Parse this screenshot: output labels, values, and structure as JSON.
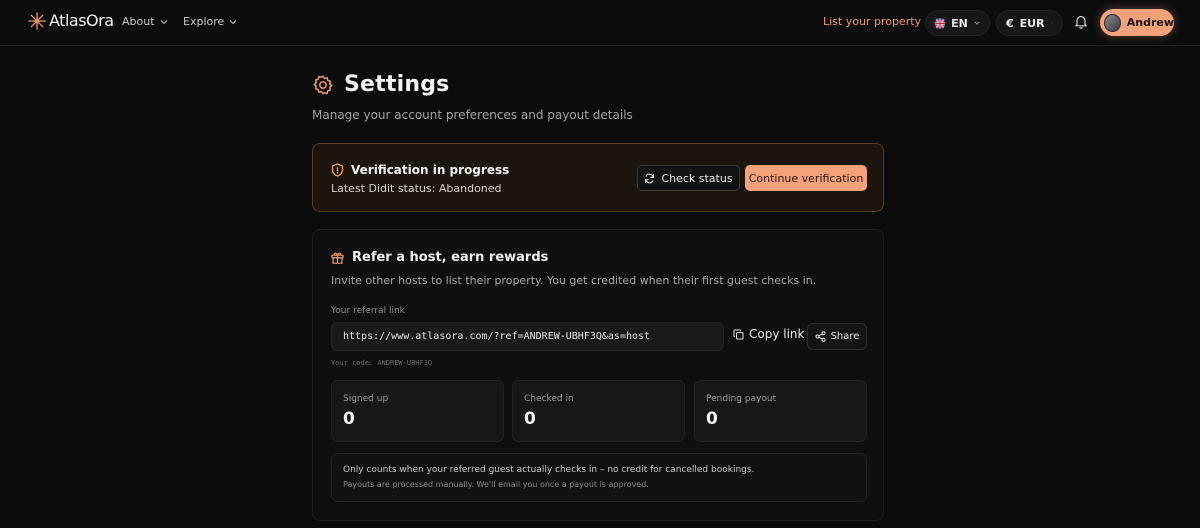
{
  "brand": {
    "name": "AtlasOra"
  },
  "nav": {
    "about": "About",
    "explore": "Explore",
    "list_property": "List your property",
    "language": "EN",
    "currency_symbol": "€",
    "currency": "EUR",
    "user": "Andrew"
  },
  "page": {
    "title": "Settings",
    "subtitle": "Manage your account preferences and payout details"
  },
  "verification": {
    "title": "Verification in progress",
    "status": "Latest Didit status: Abandoned",
    "check_label": "Check status",
    "continue_label": "Continue verification"
  },
  "referral": {
    "title": "Refer a host, earn rewards",
    "description": "Invite other hosts to list their property. You get credited when their first guest checks in.",
    "link_label": "Your referral link",
    "link": "https://www.atlasora.com/?ref=ANDREW-UBHF3Q&as=host",
    "copy_label": "Copy link",
    "share_label": "Share",
    "code_line": "Your code: ANDREW-UBHF3Q",
    "stats": [
      {
        "label": "Signed up",
        "value": "0"
      },
      {
        "label": "Checked in",
        "value": "0"
      },
      {
        "label": "Pending payout",
        "value": "0"
      }
    ],
    "note_primary": "Only counts when your referred guest actually checks in – no credit for cancelled bookings.",
    "note_secondary": "Payouts are processed manually. We'll email you once a payout is approved."
  },
  "colors": {
    "accent": "#f4a27a",
    "background": "#0b0b0c",
    "warning_border": "#5a3f1c"
  },
  "icons": [
    "brand-star-icon",
    "chevron-down-icon",
    "uk-flag-icon",
    "bell-icon",
    "avatar",
    "gear-icon",
    "shield-icon",
    "refresh-icon",
    "gift-icon",
    "copy-icon",
    "share-icon"
  ]
}
